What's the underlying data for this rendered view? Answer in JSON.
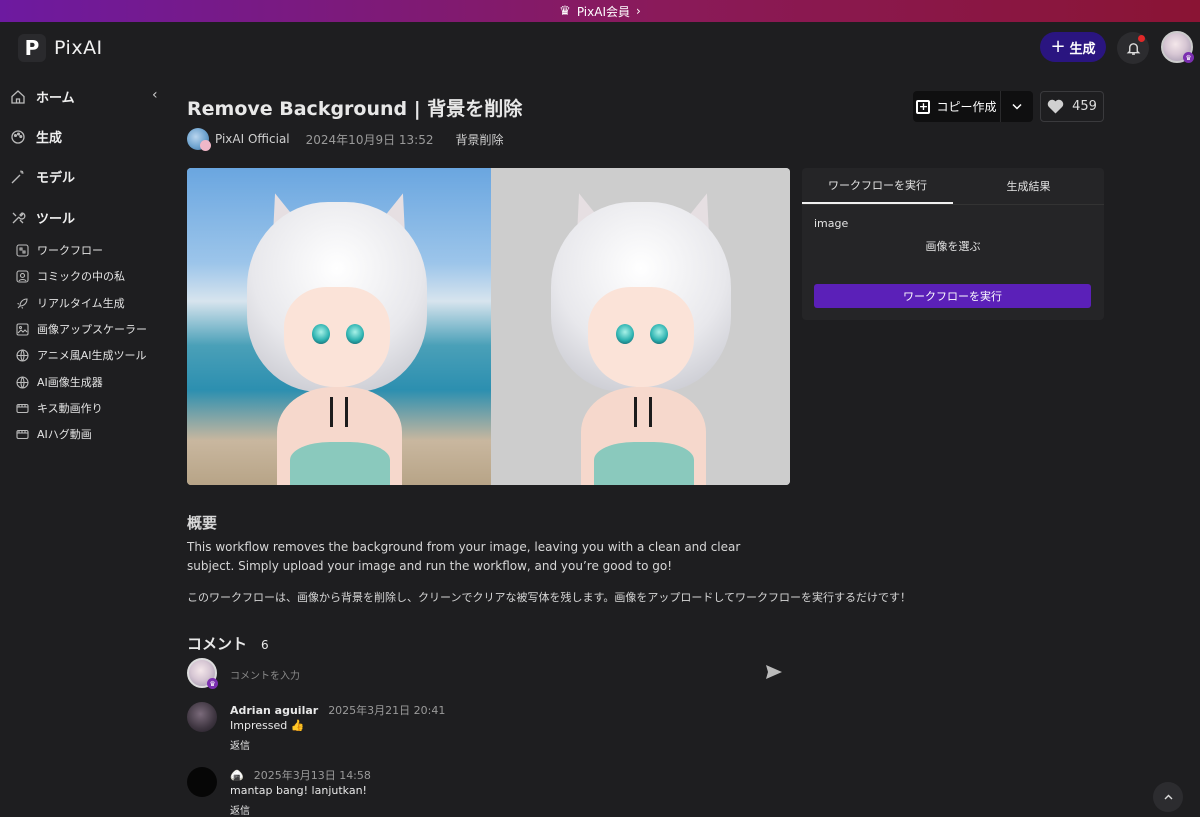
{
  "banner": {
    "label": "PixAI会員",
    "arrow": "›"
  },
  "header": {
    "logo_letter": "P",
    "logo_text": "PixAI",
    "generate_label": "生成"
  },
  "sidebar": {
    "items": [
      {
        "label": "ホーム",
        "icon": "home-icon"
      },
      {
        "label": "生成",
        "icon": "palette-icon"
      },
      {
        "label": "モデル",
        "icon": "wand-icon"
      },
      {
        "label": "ツール",
        "icon": "tools-icon"
      }
    ],
    "tools": [
      {
        "label": "ワークフロー",
        "icon": "workflow-icon"
      },
      {
        "label": "コミックの中の私",
        "icon": "portrait-icon"
      },
      {
        "label": "リアルタイム生成",
        "icon": "rocket-icon"
      },
      {
        "label": "画像アップスケーラー",
        "icon": "image-icon"
      },
      {
        "label": "アニメ風AI生成ツール",
        "icon": "globe-icon"
      },
      {
        "label": "AI画像生成器",
        "icon": "globe-icon"
      },
      {
        "label": "キス動画作り",
        "icon": "video-icon"
      },
      {
        "label": "AIハグ動画",
        "icon": "video-icon"
      }
    ]
  },
  "page": {
    "title": "Remove Background | 背景を削除",
    "author": "PixAI Official",
    "date": "2024年10月9日 13:52",
    "tag": "背景削除",
    "copy_label": "コピー作成",
    "likes": "459"
  },
  "panel": {
    "tabs": [
      "ワークフローを実行",
      "生成結果"
    ],
    "field_label": "image",
    "pick_image": "画像を選ぶ",
    "run_label": "ワークフローを実行"
  },
  "overview": {
    "heading": "概要",
    "text_en": "This workflow removes the background from your image, leaving you with a clean and clear subject. Simply upload your image and run the workflow, and you’re good to go!",
    "text_jp": "このワークフローは、画像から背景を削除し、クリーンでクリアな被写体を残します。画像をアップロードしてワークフローを実行するだけです！"
  },
  "comments": {
    "heading": "コメント",
    "count": "6",
    "placeholder": "コメントを入力",
    "items": [
      {
        "author": "Adrian aguilar",
        "date": "2025年3月21日 20:41",
        "text": "Impressed 👍",
        "reply": "返信"
      },
      {
        "author": "🍙",
        "date": "2025年3月13日 14:58",
        "text": "mantap bang! lanjutkan!",
        "reply": "返信"
      }
    ]
  },
  "colors": {
    "accent": "#5b20b8",
    "generate_button": "#2a1580",
    "background": "#1e1e20"
  }
}
